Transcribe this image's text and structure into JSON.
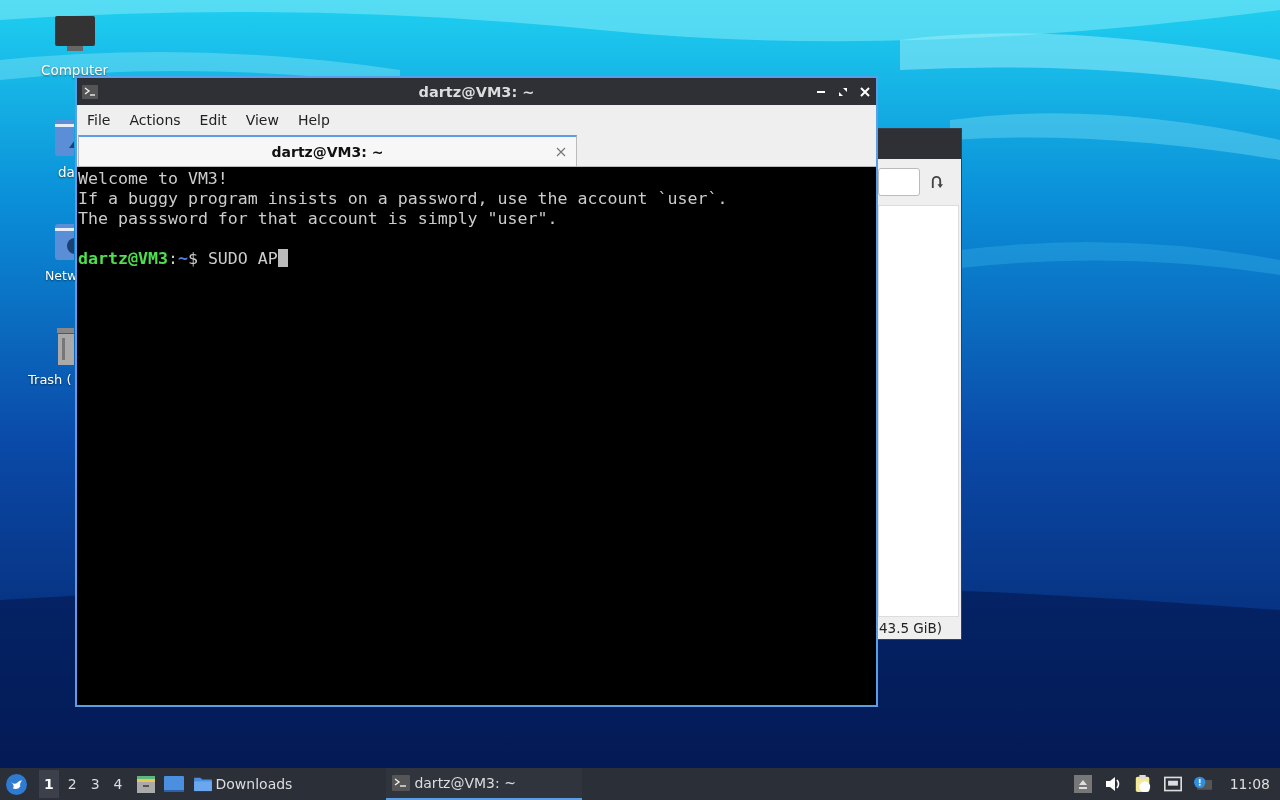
{
  "desktop_icons": [
    {
      "kind": "computer",
      "label": "Computer"
    },
    {
      "kind": "home",
      "label": "da"
    },
    {
      "kind": "network",
      "label": "Netw"
    },
    {
      "kind": "trash",
      "label": "Trash ("
    }
  ],
  "file_manager": {
    "status": "43.5 GiB)"
  },
  "terminal": {
    "title": "dartz@VM3: ~",
    "menu": [
      "File",
      "Actions",
      "Edit",
      "View",
      "Help"
    ],
    "tabs": [
      {
        "label": "dartz@VM3: ~",
        "selected": true
      }
    ],
    "lines": [
      "Welcome to VM3!",
      "If a buggy program insists on a password, use the account `user`.",
      "The passsword for that account is simply \"user\"."
    ],
    "prompt": {
      "user": "dartz@VM3",
      "separator": ":",
      "path": "~",
      "symbol": "$",
      "command": "SUDO AP"
    }
  },
  "taskbar": {
    "workspaces": [
      {
        "label": "1",
        "selected": true
      },
      {
        "label": "2",
        "selected": false
      },
      {
        "label": "3",
        "selected": false
      },
      {
        "label": "4",
        "selected": false
      }
    ],
    "tasks": [
      {
        "kind": "folder",
        "label": "Downloads",
        "selected": false
      },
      {
        "kind": "terminal",
        "label": "dartz@VM3: ~",
        "selected": true
      }
    ],
    "clock": "11:08"
  }
}
